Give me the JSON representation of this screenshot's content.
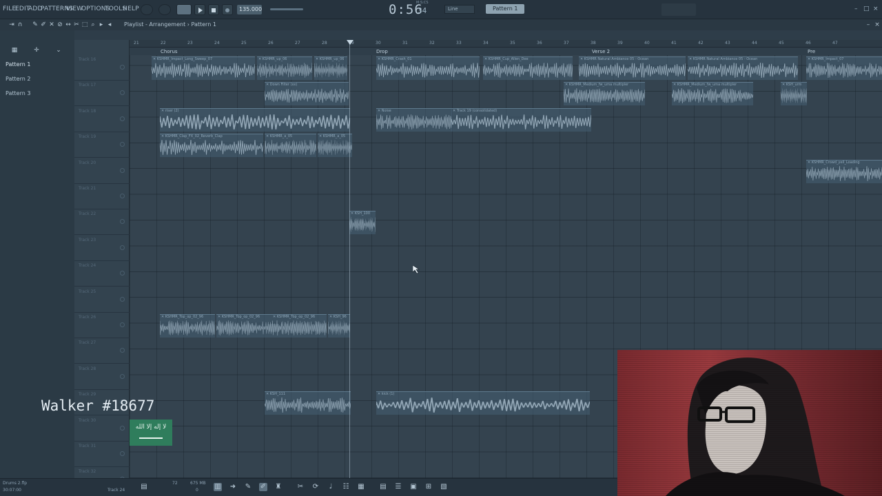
{
  "menu": {
    "file": "FILE",
    "edit": "EDIT",
    "add": "ADD",
    "patterns": "PATTERNS",
    "view": "VIEW",
    "options": "OPTIONS",
    "tools": "TOOLS",
    "help": "HELP"
  },
  "transport": {
    "tempo": "135.000",
    "time_main": "0:56",
    "time_ms": "34",
    "time_label": "M:S:CS",
    "snap": "Line",
    "pattern": "Pattern 1"
  },
  "toolbar": {
    "breadcrumb": "Playlist - Arrangement › Pattern 1"
  },
  "browser": {
    "patterns": [
      "Pattern 1",
      "Pattern 2",
      "Pattern 3"
    ]
  },
  "ruler": {
    "bars": [
      "21",
      "22",
      "23",
      "24",
      "25",
      "26",
      "27",
      "28",
      "29",
      "30",
      "31",
      "32",
      "33",
      "34",
      "35",
      "36",
      "37",
      "38",
      "39",
      "40",
      "41",
      "42",
      "43",
      "44",
      "45",
      "46",
      "47"
    ]
  },
  "markers": {
    "chorus": "Chorus",
    "drop": "Drop",
    "verse2": "Verse 2",
    "pre": "Pre"
  },
  "tracks": [
    "Track 16",
    "Track 17",
    "Track 18",
    "Track 19",
    "Track 20",
    "Track 21",
    "Track 22",
    "Track 23",
    "Track 24",
    "Track 25",
    "Track 26",
    "Track 27",
    "Track 28",
    "Track 29",
    "Track 30",
    "Track 31",
    "Track 32"
  ],
  "clips": [
    {
      "label": "KSHMR_Impact_Long_Sweep_07",
      "row": 0
    },
    {
      "label": "KSHMR_up_06",
      "row": 0
    },
    {
      "label": "KSHMR_up_06",
      "row": 0
    },
    {
      "label": "KSHMR_Crash_01",
      "row": 0
    },
    {
      "label": "KSHMR_Cup_Allen_Dee",
      "row": 0
    },
    {
      "label": "KSHMR Natural Ambiance 05 - Ocean",
      "row": 0
    },
    {
      "label": "KSHMR Natural Ambiance 05 - Ocean",
      "row": 0
    },
    {
      "label": "KSHMR_Impact_07",
      "row": 0
    },
    {
      "label": "Down Filter (xx)",
      "row": 1
    },
    {
      "label": "KSHMR_Medium_fw_uma multipler",
      "row": 1
    },
    {
      "label": "KSHMR_Medium_fw_uma multipler",
      "row": 1
    },
    {
      "label": "KSH_urm",
      "row": 1
    },
    {
      "label": "riser (2)",
      "row": 2
    },
    {
      "label": "Noise",
      "row": 2
    },
    {
      "label": "Track 19 (consolidated)",
      "row": 2
    },
    {
      "label": "KSHMR_Clap_FX_02_Reverb_Clap",
      "row": 3
    },
    {
      "label": "KSHMR_a_05",
      "row": 3
    },
    {
      "label": "KSHMR_a_05",
      "row": 3
    },
    {
      "label": "KSHMR_Crowd_yell_Loading",
      "row": 4
    },
    {
      "label": "KSH_100",
      "row": 6
    },
    {
      "label": "KSHMR_Top_op_02_96",
      "row": 10
    },
    {
      "label": "KSHMR_Top_op_02_96",
      "row": 10
    },
    {
      "label": "KSHMR_Top_op_02_96",
      "row": 10
    },
    {
      "label": "KSH_96",
      "row": 10
    },
    {
      "label": "KSH_111",
      "row": 13
    },
    {
      "label": "kick (1)",
      "row": 13
    }
  ],
  "status": {
    "left_line1": "Drums 2.flp",
    "left_line2": "30:07:00",
    "track_label": "Track 24",
    "cpu": "72",
    "mem": "675 MB",
    "poly": "0"
  },
  "overlay": {
    "name": "Walker #18677",
    "flag_text": "لا إله إلا الله"
  }
}
